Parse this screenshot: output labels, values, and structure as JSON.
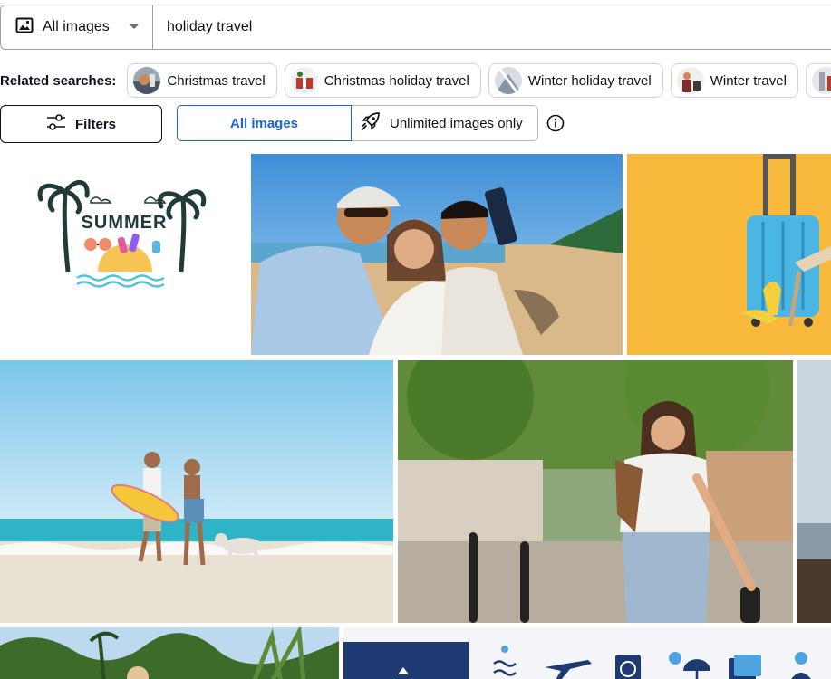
{
  "search": {
    "type_label": "All images",
    "query": "holiday travel",
    "type_icon": "image-icon",
    "dropdown_icon": "caret-down-icon"
  },
  "related": {
    "label": "Related searches:",
    "items": [
      {
        "label": "Christmas travel"
      },
      {
        "label": "Christmas holiday travel"
      },
      {
        "label": "Winter holiday travel"
      },
      {
        "label": "Winter travel"
      }
    ]
  },
  "filters": {
    "button_label": "Filters",
    "button_icon": "sliders-icon",
    "segments": [
      {
        "label": "All images",
        "selected": true
      },
      {
        "label": "Unlimited images only",
        "selected": false,
        "icon": "rocket-icon"
      }
    ],
    "info_icon": "info-icon"
  },
  "results": {
    "tile_1": {
      "text": "SUMMER"
    }
  },
  "colors": {
    "accent": "#1a64d6",
    "text": "#0c121c",
    "border": "#9aa0a6"
  }
}
